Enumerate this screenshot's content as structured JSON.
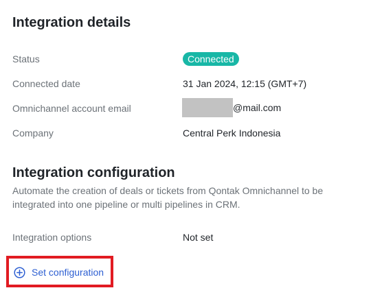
{
  "details": {
    "title": "Integration details",
    "rows": [
      {
        "label": "Status",
        "value": "Connected"
      },
      {
        "label": "Connected date",
        "value": "31 Jan 2024, 12:15 (GMT+7)"
      },
      {
        "label": "Omnichannel account email",
        "value": "@mail.com"
      },
      {
        "label": "Company",
        "value": "Central Perk Indonesia"
      }
    ]
  },
  "configuration": {
    "title": "Integration configuration",
    "description": "Automate the creation of deals or tickets from Qontak Omnichannel to be integrated into one pipeline or multi pipelines in CRM.",
    "options_label": "Integration options",
    "options_value": "Not set",
    "set_button_label": "Set configuration",
    "set_button_icon": "plus-circle-icon"
  },
  "colors": {
    "status_badge": "#18b7a6",
    "link": "#2d5fd2",
    "highlight": "#e11b22",
    "redaction": "#c2c2c2"
  }
}
